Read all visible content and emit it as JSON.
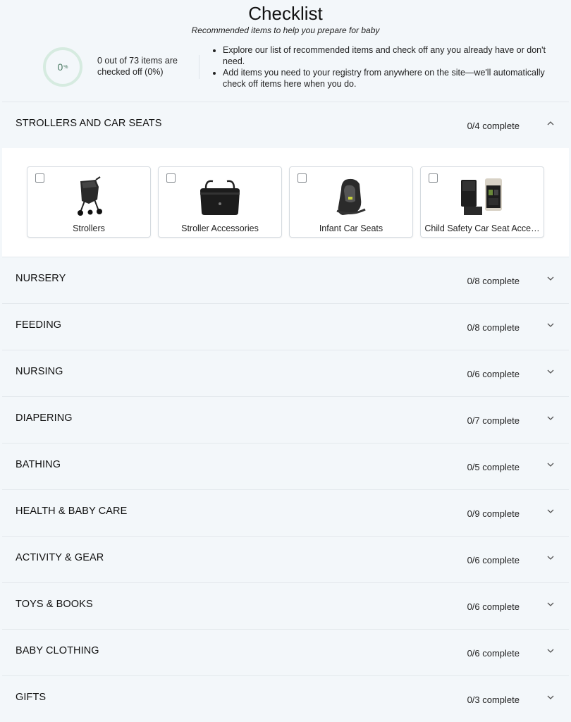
{
  "header": {
    "title": "Checklist",
    "subtitle": "Recommended items to help you prepare for baby"
  },
  "progress": {
    "percent_value": "0",
    "percent_sign": "%",
    "fraction": 0,
    "summary": "0 out of 73 items are checked off (0%)",
    "ring_color": "#cfe6da"
  },
  "tips": [
    "Explore our list of recommended items and check off any you already have or don't need.",
    "Add items you need to your registry from anywhere on the site—we'll automatically check off items here when you do."
  ],
  "sections": [
    {
      "name": "STROLLERS AND CAR SEATS",
      "count": "0/4 complete",
      "expanded": true,
      "items": [
        {
          "label": "Strollers",
          "icon": "stroller-icon"
        },
        {
          "label": "Stroller Accessories",
          "icon": "stroller-bag-icon"
        },
        {
          "label": "Infant Car Seats",
          "icon": "car-seat-icon"
        },
        {
          "label": "Child Safety Car Seat Acce…",
          "icon": "seat-protector-icon"
        }
      ]
    },
    {
      "name": "NURSERY",
      "count": "0/8 complete",
      "expanded": false
    },
    {
      "name": "FEEDING",
      "count": "0/8 complete",
      "expanded": false
    },
    {
      "name": "NURSING",
      "count": "0/6 complete",
      "expanded": false
    },
    {
      "name": "DIAPERING",
      "count": "0/7 complete",
      "expanded": false
    },
    {
      "name": "BATHING",
      "count": "0/5 complete",
      "expanded": false
    },
    {
      "name": "HEALTH & BABY CARE",
      "count": "0/9 complete",
      "expanded": false
    },
    {
      "name": "ACTIVITY & GEAR",
      "count": "0/6 complete",
      "expanded": false
    },
    {
      "name": "TOYS & BOOKS",
      "count": "0/6 complete",
      "expanded": false
    },
    {
      "name": "BABY CLOTHING",
      "count": "0/6 complete",
      "expanded": false
    },
    {
      "name": "GIFTS",
      "count": "0/3 complete",
      "expanded": false
    }
  ]
}
